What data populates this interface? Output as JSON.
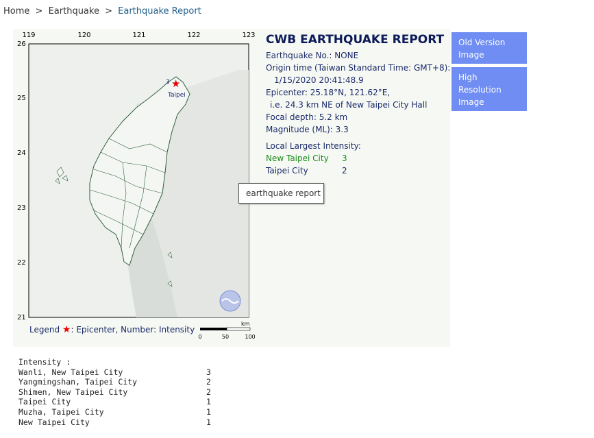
{
  "breadcrumb": {
    "home": "Home",
    "sep": ">",
    "earthquake": "Earthquake",
    "current": "Earthquake Report"
  },
  "report": {
    "title": "CWB EARTHQUAKE REPORT",
    "eq_no": "Earthquake No.: NONE",
    "origin_label": "Origin time (Taiwan Standard Time: GMT+8):",
    "origin_time": "1/15/2020 20:41:48.9",
    "epicenter": "Epicenter: 25.18°N, 121.62°E,",
    "epicenter_ref": "i.e. 24.3 km NE of New Taipei City Hall",
    "depth": "Focal depth: 5.2 km",
    "magnitude": "Magnitude (ML): 3.3",
    "local_label": "Local Largest Intensity:",
    "local": [
      {
        "name": "New Taipei City",
        "value": "3",
        "color": "#1a8a1a"
      },
      {
        "name": "Taipei City",
        "value": "2",
        "color": "#1b2a6b"
      }
    ]
  },
  "map": {
    "lon_ticks": [
      "119",
      "120",
      "121",
      "122",
      "123"
    ],
    "lat_ticks": [
      "26",
      "25",
      "24",
      "23",
      "22",
      "21"
    ],
    "epicenter_number": "3",
    "city_label": "Taipei",
    "scale_unit": "km",
    "scale_ticks": [
      "0",
      "50",
      "100"
    ],
    "legend_label": "Legend",
    "legend_text": ": Epicenter, Number: Intensity"
  },
  "buttons": {
    "old_version": "Old Version Image",
    "high_res": "High Resolution Image"
  },
  "tooltip": "earthquake report",
  "intensity": {
    "header": "Intensity :",
    "rows": [
      {
        "location": "Wanli, New Taipei City",
        "value": "3"
      },
      {
        "location": "Yangmingshan, Taipei City",
        "value": "2"
      },
      {
        "location": "Shimen, New Taipei City",
        "value": "2"
      },
      {
        "location": "Taipei City",
        "value": "1"
      },
      {
        "location": "Muzha, Taipei City",
        "value": "1"
      },
      {
        "location": "New Taipei City",
        "value": "1"
      }
    ]
  },
  "colors": {
    "button_bg": "#6f8df2",
    "title_navy": "#0d1a5a",
    "epicenter_red": "#e00000"
  }
}
